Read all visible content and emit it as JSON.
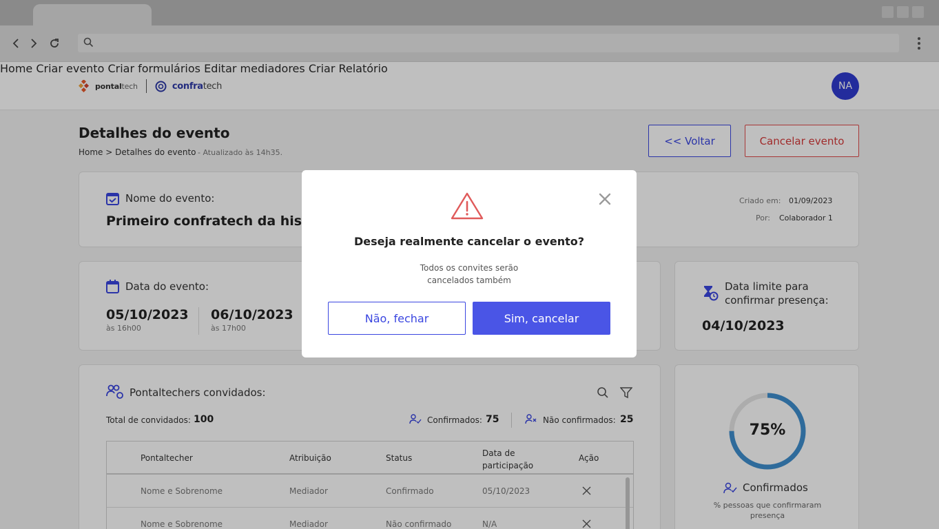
{
  "browser": {
    "url": ""
  },
  "header": {
    "logo_pontal_bold": "pontal",
    "logo_pontal_light": "tech",
    "logo_confra_bold": "confra",
    "logo_confra_light": "tech",
    "nav": [
      "Home",
      "Criar evento",
      "Criar formulários",
      "Editar mediadores",
      "Criar Relatório"
    ],
    "avatar_initials": "NA"
  },
  "page": {
    "title": "Detalhes do evento",
    "breadcrumb": "Home > Detalhes do evento",
    "updated": "- Atualizado às 14h35.",
    "back_label": "<< Voltar",
    "cancel_label": "Cancelar evento"
  },
  "event": {
    "name_label": "Nome do evento:",
    "name_value": "Primeiro confratech da história",
    "created_label": "Criado em:",
    "created_value": "01/09/2023",
    "by_label": "Por:",
    "by_value": "Colaborador 1"
  },
  "dates": {
    "label": "Data do evento:",
    "start_date": "05/10/2023",
    "start_time": "às 16h00",
    "end_date": "06/10/2023",
    "end_time": "às 17h00"
  },
  "deadline": {
    "label": "Data limite para confirmar presença:",
    "value": "04/10/2023"
  },
  "guests": {
    "title": "Pontaltechers convidados:",
    "total_label": "Total de convidados:",
    "total_value": "100",
    "confirmed_label": "Confirmados:",
    "confirmed_value": "75",
    "not_confirmed_label": "Não confirmados:",
    "not_confirmed_value": "25",
    "columns": [
      "Pontaltecher",
      "Atribuição",
      "Status",
      "Data de participação",
      "Ação"
    ],
    "rows": [
      [
        "Nome e Sobrenome",
        "Mediador",
        "Confirmado",
        "05/10/2023"
      ],
      [
        "Nome e Sobrenome",
        "Mediador",
        "Não confirmado",
        "N/A"
      ]
    ]
  },
  "stats": {
    "percent_label": "75%",
    "percent": 0.75,
    "label": "Confirmados",
    "caption": "% pessoas que confirmaram presença"
  },
  "modal": {
    "title": "Deseja realmente cancelar o evento?",
    "subtitle_line1": "Todos os convites serão",
    "subtitle_line2": "cancelados também",
    "no_label": "Não, fechar",
    "yes_label": "Sim, cancelar"
  },
  "colors": {
    "accent": "#4a55e6",
    "danger": "#e04a4a",
    "ring": "#3f8fcf"
  }
}
